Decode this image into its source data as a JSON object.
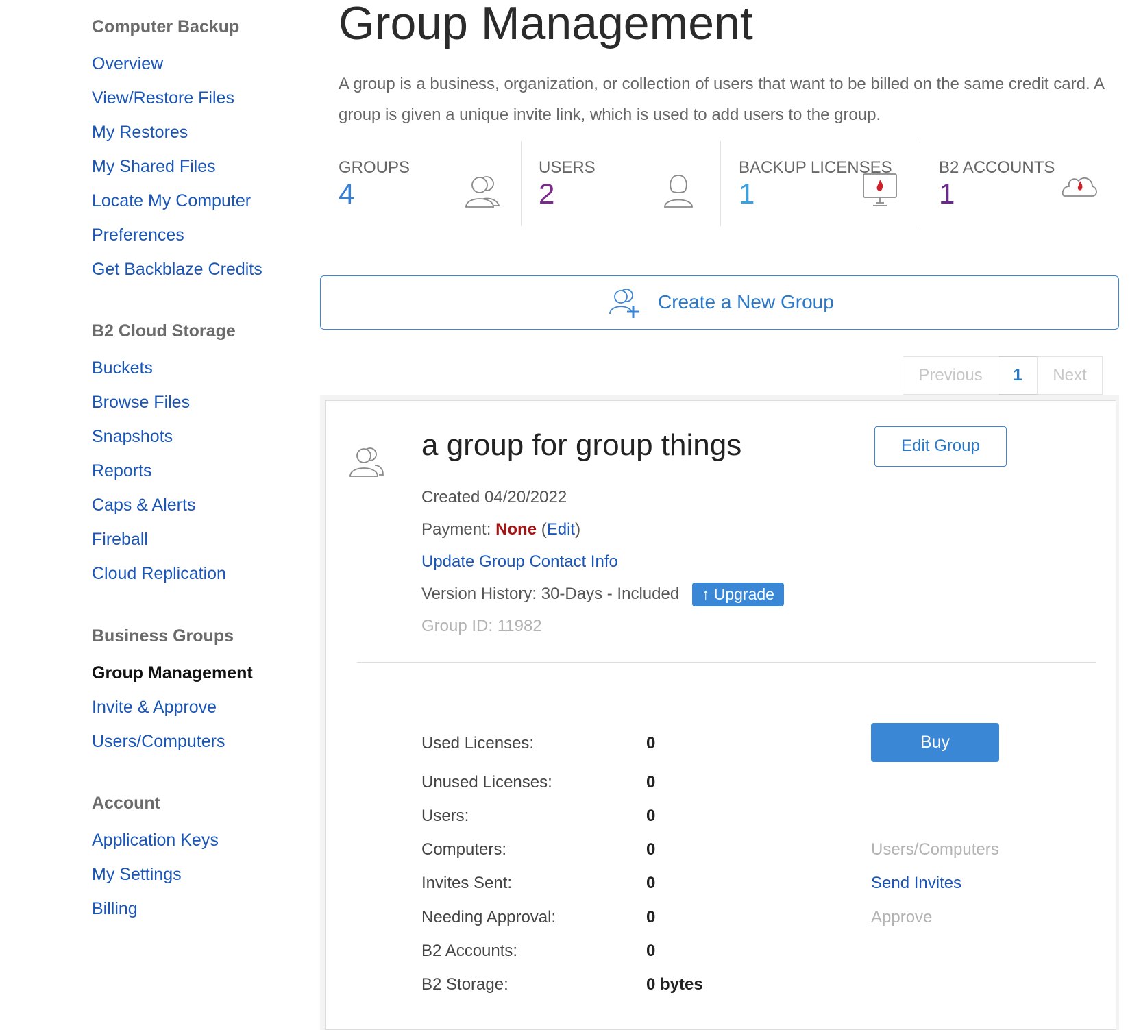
{
  "sidebar": {
    "sections": [
      {
        "heading": "Computer Backup",
        "items": [
          "Overview",
          "View/Restore Files",
          "My Restores",
          "My Shared Files",
          "Locate My Computer",
          "Preferences",
          "Get Backblaze Credits"
        ]
      },
      {
        "heading": "B2 Cloud Storage",
        "items": [
          "Buckets",
          "Browse Files",
          "Snapshots",
          "Reports",
          "Caps & Alerts",
          "Fireball",
          "Cloud Replication"
        ]
      },
      {
        "heading": "Business Groups",
        "items": [
          "Group Management",
          "Invite & Approve",
          "Users/Computers"
        ],
        "active": "Group Management"
      },
      {
        "heading": "Account",
        "items": [
          "Application Keys",
          "My Settings",
          "Billing"
        ]
      }
    ]
  },
  "page": {
    "title": "Group Management",
    "description": "A group is a business, organization, or collection of users that want to be billed on the same credit card. A group is given a unique invite link, which is used to add users to the group."
  },
  "stats": [
    {
      "label": "GROUPS",
      "value": "4",
      "color": "#3a7fd0",
      "icon": "group-user-icon"
    },
    {
      "label": "USERS",
      "value": "2",
      "color": "#7a2a8a",
      "icon": "user-icon"
    },
    {
      "label": "BACKUP LICENSES",
      "value": "1",
      "color": "#3aa0e0",
      "icon": "monitor-flame-icon"
    },
    {
      "label": "B2 ACCOUNTS",
      "value": "1",
      "color": "#6a2a8a",
      "icon": "cloud-flame-icon"
    }
  ],
  "create_group": {
    "label": "Create a New Group",
    "icon": "add-group-icon"
  },
  "pagination": {
    "previous": "Previous",
    "current": "1",
    "next": "Next"
  },
  "group": {
    "name": "a group for group things",
    "edit_label": "Edit Group",
    "created": "Created 04/20/2022",
    "payment_label": "Payment:",
    "payment_value": "None",
    "payment_edit": "Edit",
    "update_contact": "Update Group Contact Info",
    "version_history": "Version History: 30-Days - Included",
    "upgrade_label": "↑ Upgrade",
    "group_id": "Group ID: 11982",
    "buy_label": "Buy",
    "rows": [
      {
        "label": "Used Licenses:",
        "value": "0"
      },
      {
        "label": "Unused Licenses:",
        "value": "0"
      },
      {
        "label": "Users:",
        "value": "0"
      },
      {
        "label": "Computers:",
        "value": "0"
      },
      {
        "label": "Invites Sent:",
        "value": "0"
      },
      {
        "label": "Needing Approval:",
        "value": "0"
      },
      {
        "label": "B2 Accounts:",
        "value": "0"
      },
      {
        "label": "B2 Storage:",
        "value": "0 bytes"
      }
    ],
    "side_links": {
      "users_computers": "Users/Computers",
      "send_invites": "Send Invites",
      "approve": "Approve"
    }
  }
}
